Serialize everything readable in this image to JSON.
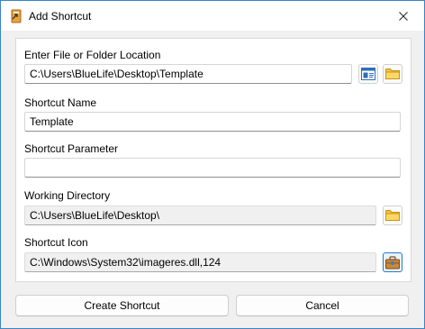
{
  "window": {
    "title": "Add Shortcut",
    "app_icon": "shortcut-app-icon",
    "close_icon": "close-icon"
  },
  "form": {
    "location": {
      "label": "Enter File or Folder Location",
      "value": "C:\\Users\\BlueLife\\Desktop\\Template",
      "browse_file_icon": "window-file-icon",
      "browse_folder_icon": "folder-icon"
    },
    "name": {
      "label": "Shortcut Name",
      "value": "Template"
    },
    "parameter": {
      "label": "Shortcut Parameter",
      "value": ""
    },
    "working_directory": {
      "label": "Working Directory",
      "value": "C:\\Users\\BlueLife\\Desktop\\",
      "browse_folder_icon": "folder-icon"
    },
    "icon": {
      "label": "Shortcut Icon",
      "value": "C:\\Windows\\System32\\imageres.dll,124",
      "pick_icon": "briefcase-icon"
    }
  },
  "buttons": {
    "create": "Create Shortcut",
    "cancel": "Cancel"
  },
  "colors": {
    "accent": "#3a84c6",
    "folder": "#f5c242"
  }
}
